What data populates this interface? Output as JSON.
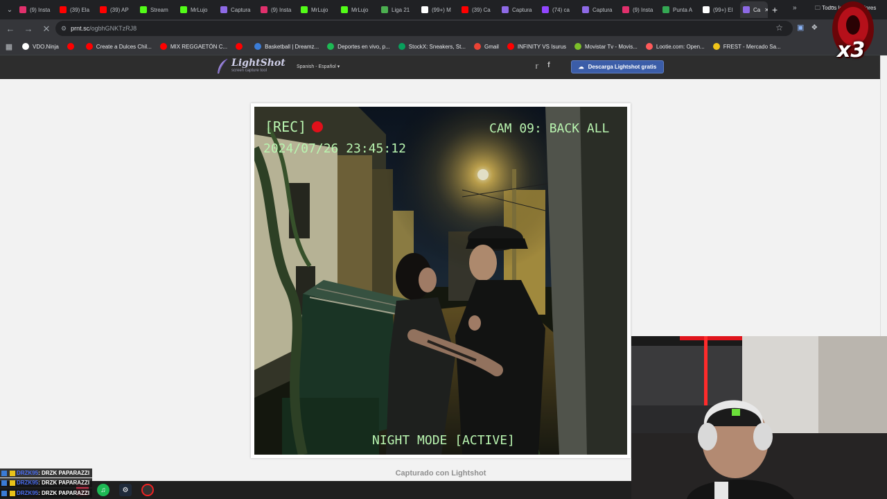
{
  "browser": {
    "tabs": [
      {
        "label": "(9) Insta",
        "fav": "#e1306c",
        "active": false
      },
      {
        "label": "(39) Ela",
        "fav": "#ff0000",
        "active": false
      },
      {
        "label": "(39) AP",
        "fav": "#ff0000",
        "active": false
      },
      {
        "label": "Stream",
        "fav": "#53fc18",
        "active": false
      },
      {
        "label": "MrLujo",
        "fav": "#53fc18",
        "active": false
      },
      {
        "label": "Captura",
        "fav": "#8e6ae6",
        "active": false
      },
      {
        "label": "(9) Insta",
        "fav": "#e1306c",
        "active": false
      },
      {
        "label": "MrLujo",
        "fav": "#53fc18",
        "active": false
      },
      {
        "label": "MrLujo",
        "fav": "#53fc18",
        "active": false
      },
      {
        "label": "Liga 21",
        "fav": "#4caf50",
        "active": false
      },
      {
        "label": "(99+) M",
        "fav": "#ffffff",
        "active": false
      },
      {
        "label": "(39) Ca",
        "fav": "#ff0000",
        "active": false
      },
      {
        "label": "Captura",
        "fav": "#8e6ae6",
        "active": false
      },
      {
        "label": "(74) ca",
        "fav": "#9146ff",
        "active": false
      },
      {
        "label": "Captura",
        "fav": "#8e6ae6",
        "active": false
      },
      {
        "label": "(9) Insta",
        "fav": "#e1306c",
        "active": false
      },
      {
        "label": "Punta A",
        "fav": "#34a853",
        "active": false
      },
      {
        "label": "(99+) El",
        "fav": "#ffffff",
        "active": false
      },
      {
        "label": "Ca",
        "fav": "#8e6ae6",
        "active": true
      }
    ],
    "url_host": "prnt.sc",
    "url_path": "/ogbhGNKTzRJ8",
    "bookmarks": [
      {
        "label": "VDO.Ninja",
        "fav": "#ffffff"
      },
      {
        "label": "",
        "fav": "#ff0000"
      },
      {
        "label": "Create a Dulces Chil...",
        "fav": "#ff0000"
      },
      {
        "label": "MIX REGGAETÓN C...",
        "fav": "#ff0000"
      },
      {
        "label": "",
        "fav": "#ff0000"
      },
      {
        "label": "Basketball | Dreamz...",
        "fav": "#3b7dd8"
      },
      {
        "label": "Deportes en vivo, p...",
        "fav": "#1db954"
      },
      {
        "label": "StockX: Sneakers, St...",
        "fav": "#08a05c"
      },
      {
        "label": "Gmail",
        "fav": "#ea4335"
      },
      {
        "label": "INFINITY VS Isurus",
        "fav": "#ff0000"
      },
      {
        "label": "Movistar Tv - Movis...",
        "fav": "#7cbf2a"
      },
      {
        "label": "Lootie.com: Open...",
        "fav": "#ff5a5a"
      },
      {
        "label": "FREST - Mercado Sa...",
        "fav": "#f0c419"
      }
    ],
    "bookmarks_folder": "Todos los marcadores"
  },
  "lightshot": {
    "logo_title": "LightShot",
    "logo_subtitle": "screen capture tool",
    "language": "Spanish - Español",
    "download_label": "Descarga Lightshot gratis",
    "captured_label": "Capturado con Lightshot",
    "screenshot": {
      "rec_label": "[REC]",
      "cam_label": "CAM 09: BACK ALL",
      "timestamp": "2024/07/26 23:45:12",
      "mode_label": "NIGHT MODE [ACTIVE]",
      "overlay_color": "#b9f5b0",
      "rec_dot_color": "#e0101a"
    }
  },
  "overlay": {
    "multiplier": "x3",
    "chat": [
      {
        "user": "DRZK95",
        "text": ": DRZK PAPARAZZI"
      },
      {
        "user": "DRZK95",
        "text": ": DRZK PAPARAZZI"
      },
      {
        "user": "DRZK95",
        "text": ": DRZK PAPARAZZI"
      }
    ]
  }
}
